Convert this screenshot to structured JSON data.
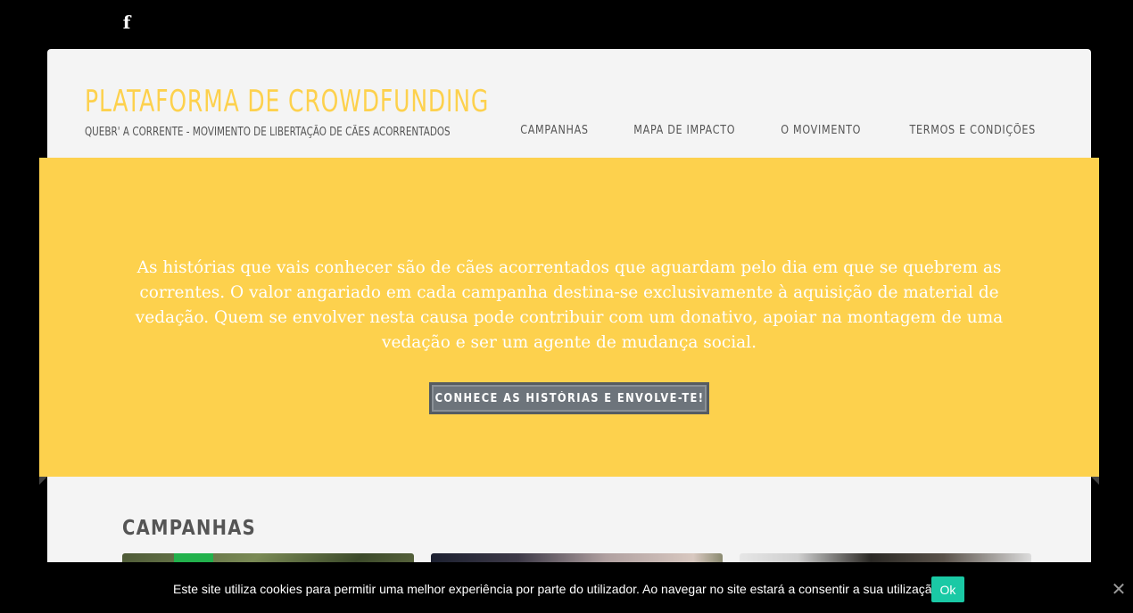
{
  "social": {
    "facebook_glyph": "f"
  },
  "header": {
    "title": "PLATAFORMA DE CROWDFUNDING",
    "tagline": "QUEBR' A CORRENTE - MOVIMENTO DE LIBERTAÇÃO DE CÃES ACORRENTADOS"
  },
  "nav": {
    "items": [
      {
        "label": "CAMPANHAS"
      },
      {
        "label": "MAPA DE IMPACTO"
      },
      {
        "label": "O MOVIMENTO"
      },
      {
        "label": "TERMOS E CONDIÇÕES"
      }
    ]
  },
  "hero": {
    "text": "As histórias que vais conhecer são de cães acorrentados que aguardam pelo dia em que se quebrem as correntes. O valor angariado em cada campanha destina-se exclusivamente à aquisição de material de vedação. Quem se envolver nesta causa pode contribuir com um donativo, apoiar na montagem de uma vedação e ser um agente de mudança social.",
    "button_label": "CONHECE AS HISTÓRIAS E ENVOLVE-TE!"
  },
  "campaigns": {
    "title": "CAMPANHAS"
  },
  "cookie_bar": {
    "text": "Este site utiliza cookies para permitir uma melhor experiência por parte do utilizador. Ao navegar no site estará a consentir a sua utilização.",
    "ok_label": "Ok",
    "close_glyph": "✕"
  },
  "colors": {
    "accent": "#fdd14d",
    "button": "#6d747b",
    "cookie_ok": "#1ac9a5"
  }
}
